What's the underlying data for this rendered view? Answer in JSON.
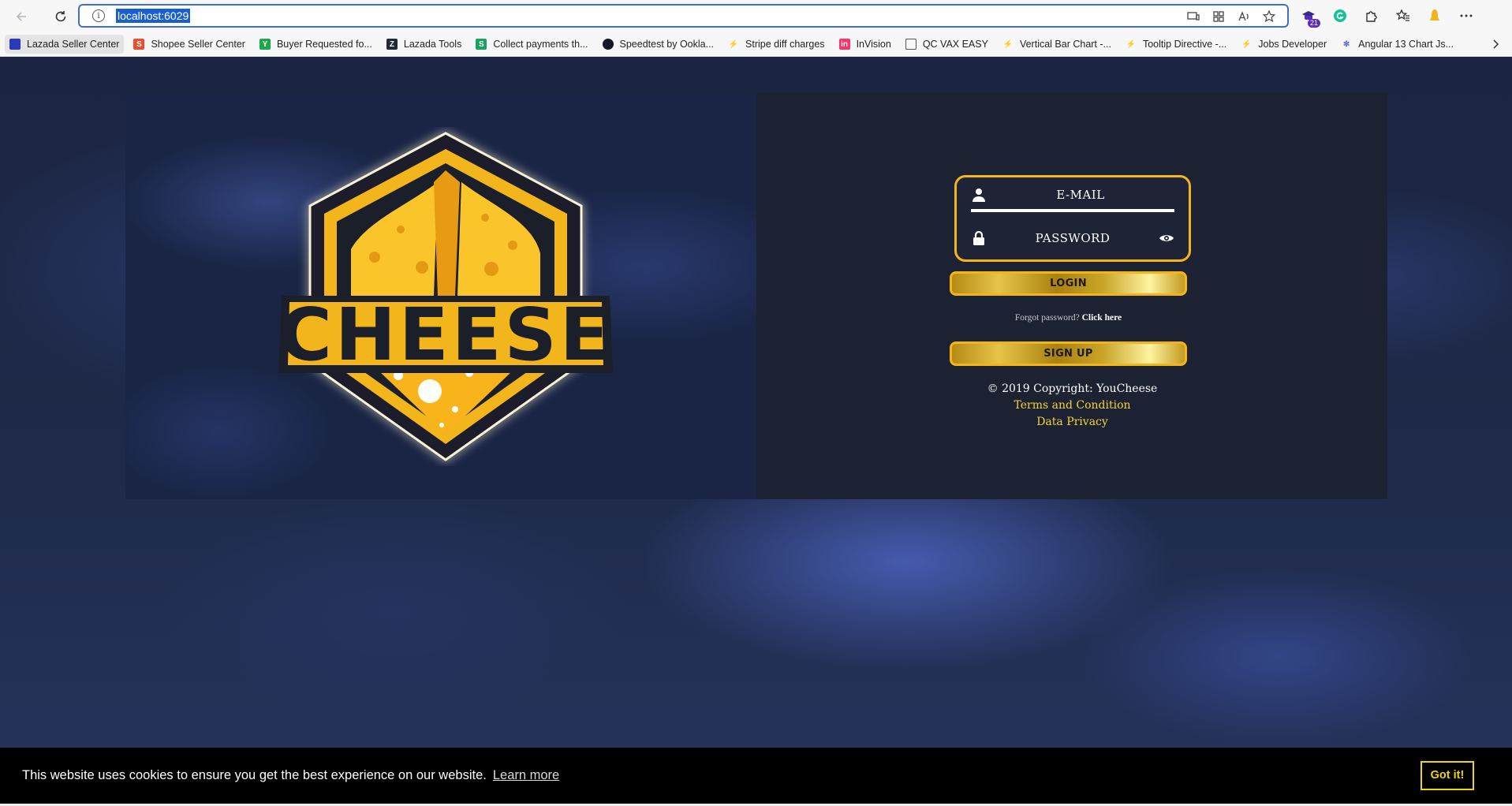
{
  "browser": {
    "url": "localhost:6029",
    "extension_badge": "21",
    "bookmarks": [
      {
        "label": "Lazada Seller Center",
        "color": "#2a3ab8"
      },
      {
        "label": "Shopee Seller Center",
        "color": "#ee4d2d"
      },
      {
        "label": "Buyer Requested fo...",
        "color": "#1ba94c"
      },
      {
        "label": "Lazada Tools",
        "color": "#1f2a3a"
      },
      {
        "label": "Collect payments th...",
        "color": "#1aa260"
      },
      {
        "label": "Speedtest by Ookla...",
        "color": "#141526"
      },
      {
        "label": "Stripe diff charges",
        "color": "#e09a3b"
      },
      {
        "label": "InVision",
        "color": "#ff3366"
      },
      {
        "label": "QC VAX EASY",
        "color": "#555555"
      },
      {
        "label": "Vertical Bar Chart -...",
        "color": "#2f7be5"
      },
      {
        "label": "Tooltip Directive -...",
        "color": "#2f7be5"
      },
      {
        "label": "Jobs Developer",
        "color": "#e09a3b"
      },
      {
        "label": "Angular 13 Chart Js...",
        "color": "#5a6bd8"
      }
    ]
  },
  "logo": {
    "text": "CHEESE"
  },
  "login": {
    "email_label": "E-MAIL",
    "password_label": "PASSWORD",
    "login_button": "LOGIN",
    "forgot_text": "Forgot password?",
    "forgot_link": "Click here",
    "signup_button": "SIGN UP"
  },
  "footer": {
    "copyright": "© 2019 Copyright: YouCheese",
    "terms": "Terms and Condition",
    "privacy": "Data Privacy"
  },
  "cookie": {
    "message": "This website uses cookies to ensure you get the best experience on our website.",
    "learn_more": "Learn more",
    "accept": "Got it!"
  },
  "colors": {
    "accent": "#f2b51b",
    "link": "#f2d23a",
    "cookie_button": "#f1d600"
  }
}
